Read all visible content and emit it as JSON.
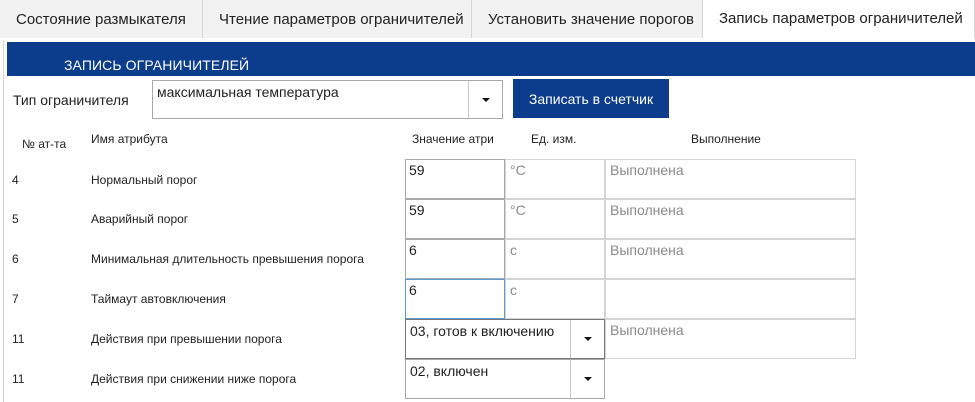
{
  "tabs": [
    {
      "label": "Состояние размыкателя"
    },
    {
      "label": "Чтение параметров ограничителей"
    },
    {
      "label": "Установить значение порогов"
    },
    {
      "label": "Запись параметров ограничителей"
    }
  ],
  "active_tab": 3,
  "panel": {
    "title": "ЗАПИСЬ ОГРАНИЧИТЕЛЕЙ",
    "limiter_type_label": "Тип ограничителя",
    "limiter_type_value": "максимальная температура",
    "write_button": "Записать в счетчик"
  },
  "columns": {
    "num": "№ ат-та",
    "name": "Имя атрибута",
    "value": "Значение атри",
    "unit": "Ед. изм.",
    "exec": "Выполнение"
  },
  "rows": [
    {
      "num": "4",
      "name": "Нормальный порог",
      "value": "59",
      "unit": "°C",
      "exec": "Выполнена"
    },
    {
      "num": "5",
      "name": "Аварийный порог",
      "value": "59",
      "unit": "°C",
      "exec": "Выполнена"
    },
    {
      "num": "6",
      "name": "Минимальная длительность превышения порога",
      "value": "6",
      "unit": "с",
      "exec": "Выполнена"
    },
    {
      "num": "7",
      "name": "Таймаут автовключения",
      "value": "6",
      "unit": "с",
      "exec": ""
    },
    {
      "num": "11",
      "name": "Действия при превышении порога",
      "value": "03, готов к включению",
      "unit": "",
      "exec": "Выполнена"
    },
    {
      "num": "11",
      "name": "Действия при снижении ниже порога",
      "value": "02, включен",
      "unit": "",
      "exec": ""
    }
  ],
  "colors": {
    "accent": "#0c3c8c",
    "focus_border": "#5b9bd5"
  }
}
